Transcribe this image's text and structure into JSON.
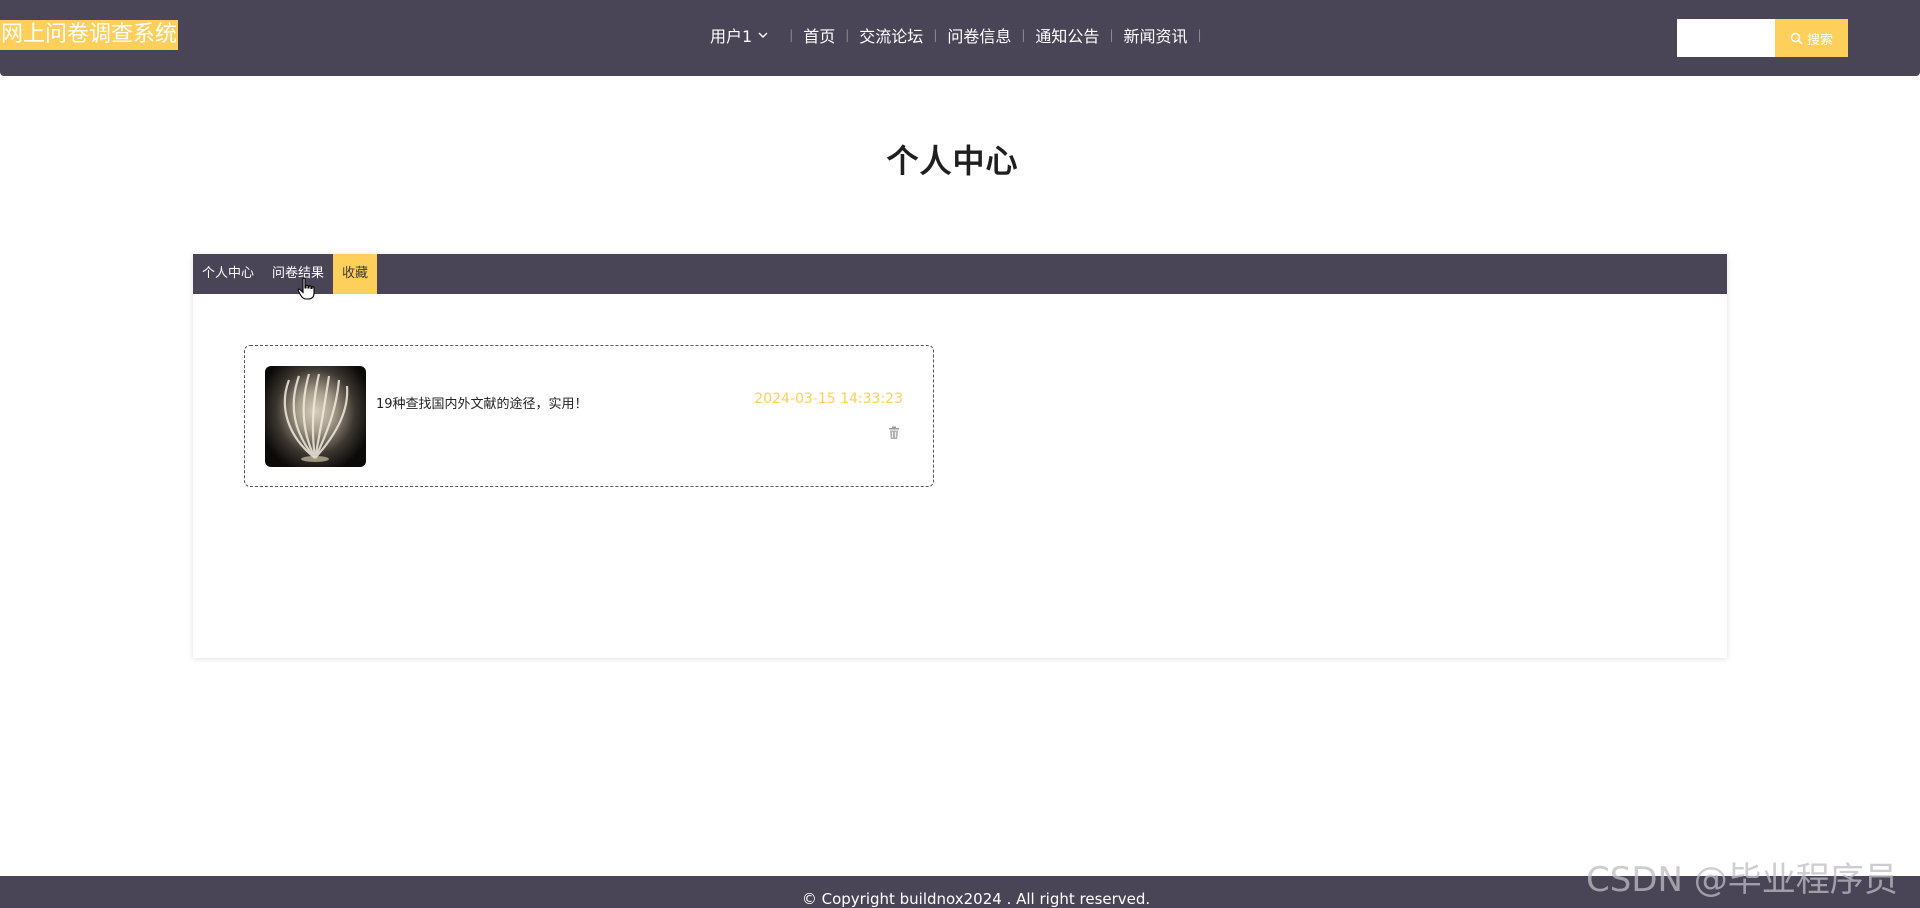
{
  "header": {
    "logo_text": "网上问卷调查系统",
    "user_menu_label": "用户1",
    "nav_items": [
      "首页",
      "交流论坛",
      "问卷信息",
      "通知公告",
      "新闻资讯"
    ],
    "search": {
      "placeholder": "",
      "button_label": "搜索"
    }
  },
  "page": {
    "title": "个人中心"
  },
  "tabs": [
    {
      "label": "个人中心",
      "active": false
    },
    {
      "label": "问卷结果",
      "active": false
    },
    {
      "label": "收藏",
      "active": true
    }
  ],
  "favorites": [
    {
      "title": "19种查找国内外文献的途径，实用！",
      "date": "2024-03-15 14:33:23",
      "thumb_icon": "book-lamp-image",
      "delete_icon": "trash-icon"
    }
  ],
  "footer": {
    "copyright": "© Copyright buildnox2024 . All right reserved."
  },
  "watermark": "CSDN @毕业程序员",
  "colors": {
    "primary_dark": "#4a4457",
    "accent": "#ffcf5c"
  }
}
